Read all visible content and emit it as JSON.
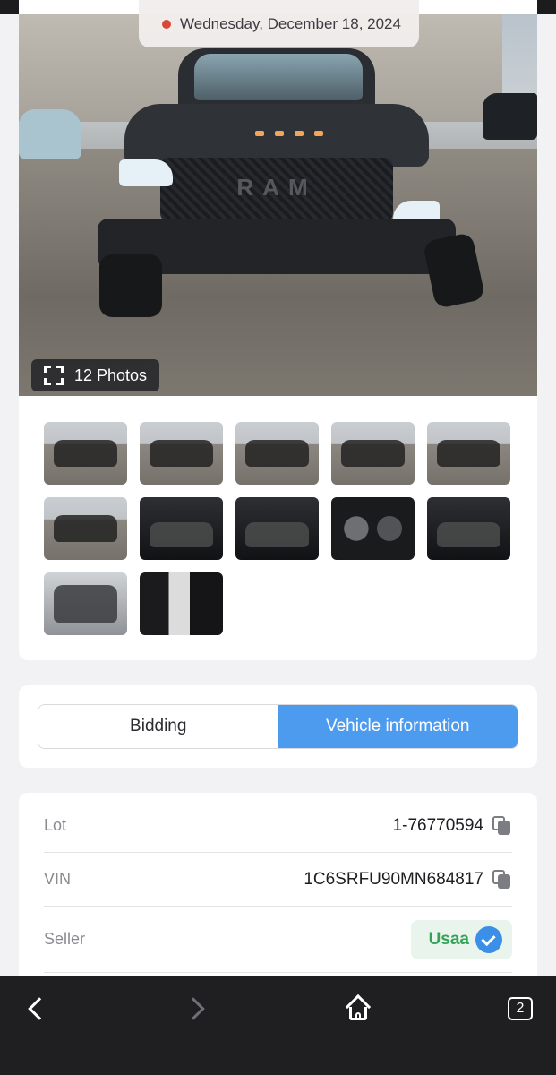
{
  "listing": {
    "sale_date": "Wednesday, December 18, 2024",
    "photo_count_label": "12 Photos",
    "thumbnails": [
      "ext",
      "ext",
      "ext",
      "ext",
      "ext",
      "ext",
      "int",
      "int",
      "dash",
      "int",
      "engine",
      "doc"
    ]
  },
  "tabs": [
    {
      "label": "Bidding",
      "active": false
    },
    {
      "label": "Vehicle information",
      "active": true
    }
  ],
  "vehicle_info": {
    "lot_label": "Lot",
    "lot_value": "1-76770594",
    "vin_label": "VIN",
    "vin_value": "1C6SRFU90MN684817",
    "seller_label": "Seller",
    "seller_value": "Usaa"
  },
  "browser": {
    "tab_count": "2"
  },
  "colors": {
    "accent": "#4d9bef",
    "seller_green": "#35a25a",
    "live_dot": "#d9473a"
  }
}
